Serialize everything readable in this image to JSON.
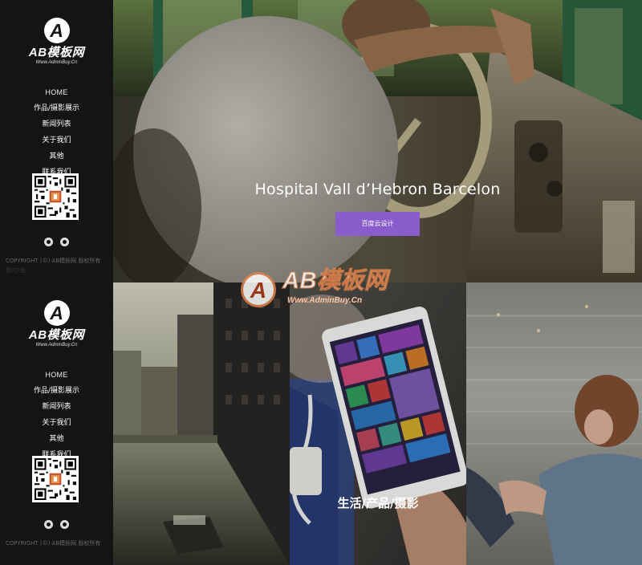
{
  "brand": {
    "logo_mark": "A",
    "name": "AB模板网",
    "domain": "Www.AdminBuy.Cn"
  },
  "nav": {
    "items": [
      "HOME",
      "作品/摄影展示",
      "新闻列表",
      "关于我们",
      "其他",
      "联系我们"
    ]
  },
  "social": {
    "icons": [
      "weibo-icon",
      "qq-icon"
    ]
  },
  "footer": {
    "copyright": "COPYRIGHT (©) AB模板网 版权所有",
    "extra": "蜀ICP备"
  },
  "hero": {
    "title": "Hospital Vall d’Hebron Barcelon",
    "button_label": "百度云设计",
    "accent_color": "#8a5ccc"
  },
  "gallery": {
    "caption": "生活/产品/摄影"
  },
  "watermark": {
    "mark": "A",
    "title": "AB模板网",
    "url": "Www.AdminBuy.Cn",
    "accent_color": "#e0814a"
  }
}
